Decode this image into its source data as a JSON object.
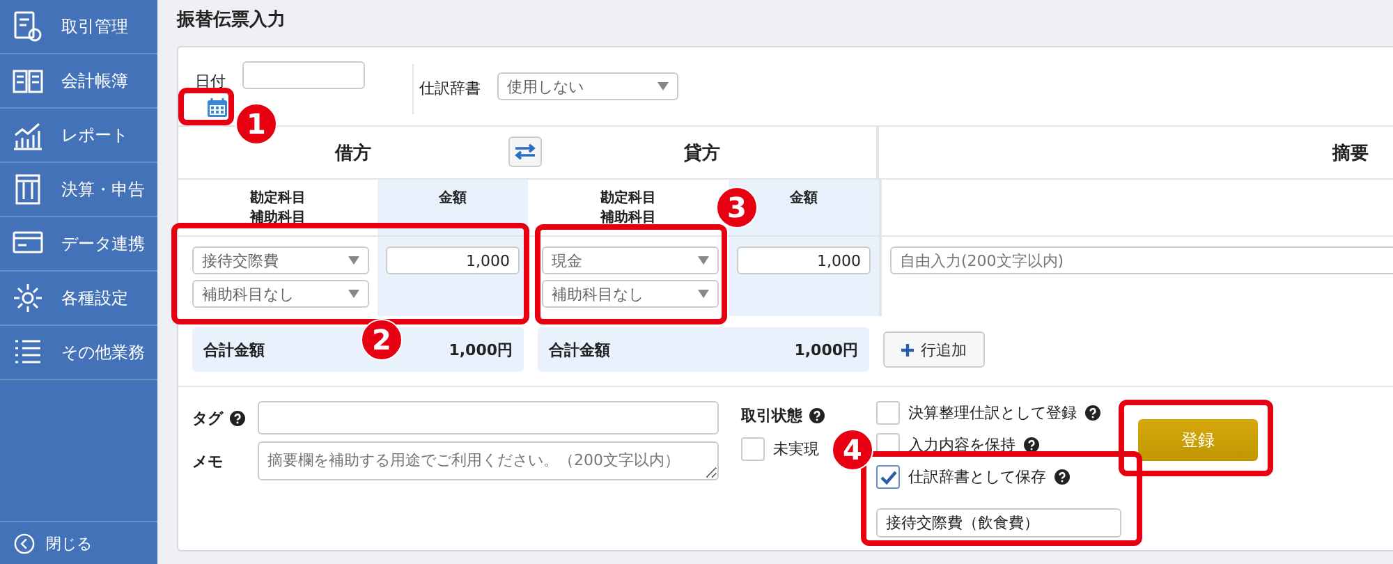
{
  "sidebar": {
    "items": [
      {
        "label": "取引管理"
      },
      {
        "label": "会計帳簿"
      },
      {
        "label": "レポート"
      },
      {
        "label": "決算・申告"
      },
      {
        "label": "データ連携"
      },
      {
        "label": "各種設定"
      },
      {
        "label": "その他業務"
      }
    ],
    "close_label": "閉じる"
  },
  "page_title": "振替伝票入力",
  "date": {
    "label": "日付"
  },
  "journal_dictionary": {
    "label": "仕訳辞書",
    "value": "使用しない"
  },
  "debit": {
    "heading": "借方",
    "account_heading": "勘定科目",
    "sub_account_heading": "補助科目",
    "amount_heading": "金額",
    "account": "接待交際費",
    "sub_account": "補助科目なし",
    "amount": "1,000",
    "total_label": "合計金額",
    "total": "1,000円"
  },
  "credit": {
    "heading": "貸方",
    "account_heading": "勘定科目",
    "sub_account_heading": "補助科目",
    "amount_heading": "金額",
    "account": "現金",
    "sub_account": "補助科目なし",
    "amount": "1,000",
    "total_label": "合計金額",
    "total": "1,000円"
  },
  "description": {
    "heading": "摘要",
    "placeholder": "自由入力(200文字以内)"
  },
  "add_row_button": {
    "label": "行追加"
  },
  "tag": {
    "label": "タグ"
  },
  "memo": {
    "label": "メモ",
    "placeholder": "摘要欄を補助する用途でご利用ください。（200文字以内）"
  },
  "transaction_status": {
    "label": "取引状態",
    "options": [
      {
        "label": "未実現",
        "checked": false
      }
    ]
  },
  "options": [
    {
      "label": "決算整理仕訳として登録",
      "checked": false
    },
    {
      "label": "入力内容を保持",
      "checked": false
    },
    {
      "label": "仕訳辞書として保存",
      "checked": true
    }
  ],
  "dictionary_name": {
    "value": "接待交際費（飲食費）"
  },
  "register_button": {
    "label": "登録"
  },
  "annotations": [
    {
      "number": "1"
    },
    {
      "number": "2"
    },
    {
      "number": "3"
    },
    {
      "number": "4"
    }
  ]
}
